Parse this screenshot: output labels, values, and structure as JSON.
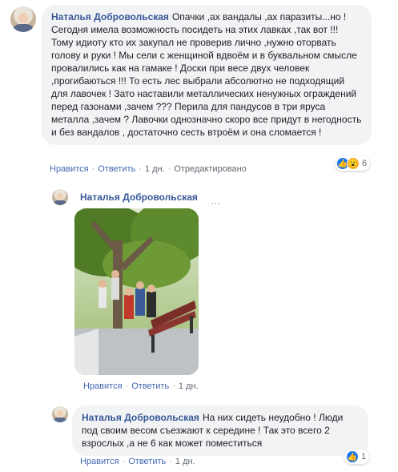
{
  "comments": [
    {
      "author": "Наталья Добровольская",
      "text": "Опачки ,ах вандалы ,ах паразиты...но ! Сегодня имела возможность посидеть на этих лавках ,так вот !!! Тому идиоту кто их закупал не проверив лично ,нужно оторвать голову и руки ! Мы сели с женщиной вдвоём и в буквальном смысле провалились как на гамаке ! Доски при весе двух человек ,прогибаються !!! То есть лес выбрали абсолютно не подходящий для лавочек ! Зато наставили металлических ненужных ограждений перед газонами ,зачем ??? Перила для пандусов в три яруса металла ,зачем ? Лавочки однозначно скоро все придут в негодность и без вандалов , достаточно сесть втроём и она сломается !",
      "like": "Нравится",
      "reply": "Ответить",
      "time": "1 дн.",
      "edited": "Отредактировано",
      "reactions_count": "6"
    },
    {
      "author": "Наталья Добровольская",
      "like": "Нравится",
      "reply": "Ответить",
      "time": "1 дн."
    },
    {
      "author": "Наталья Добровольская",
      "text": "На них сидеть неудобно ! Люди под своим весом съезжают к середине ! Так это всего 2 взрослых ,а не 6 как может поместиться",
      "like": "Нравится",
      "reply": "Ответить",
      "time": "1 дн.",
      "reactions_count": "1"
    }
  ],
  "separator": "·",
  "icons": {
    "like": "like-reaction-icon",
    "wow": "wow-reaction-icon"
  },
  "colors": {
    "author": "#385898",
    "link": "#4267b2",
    "bubble": "#f2f3f5",
    "like_blue": "#1877f2"
  }
}
